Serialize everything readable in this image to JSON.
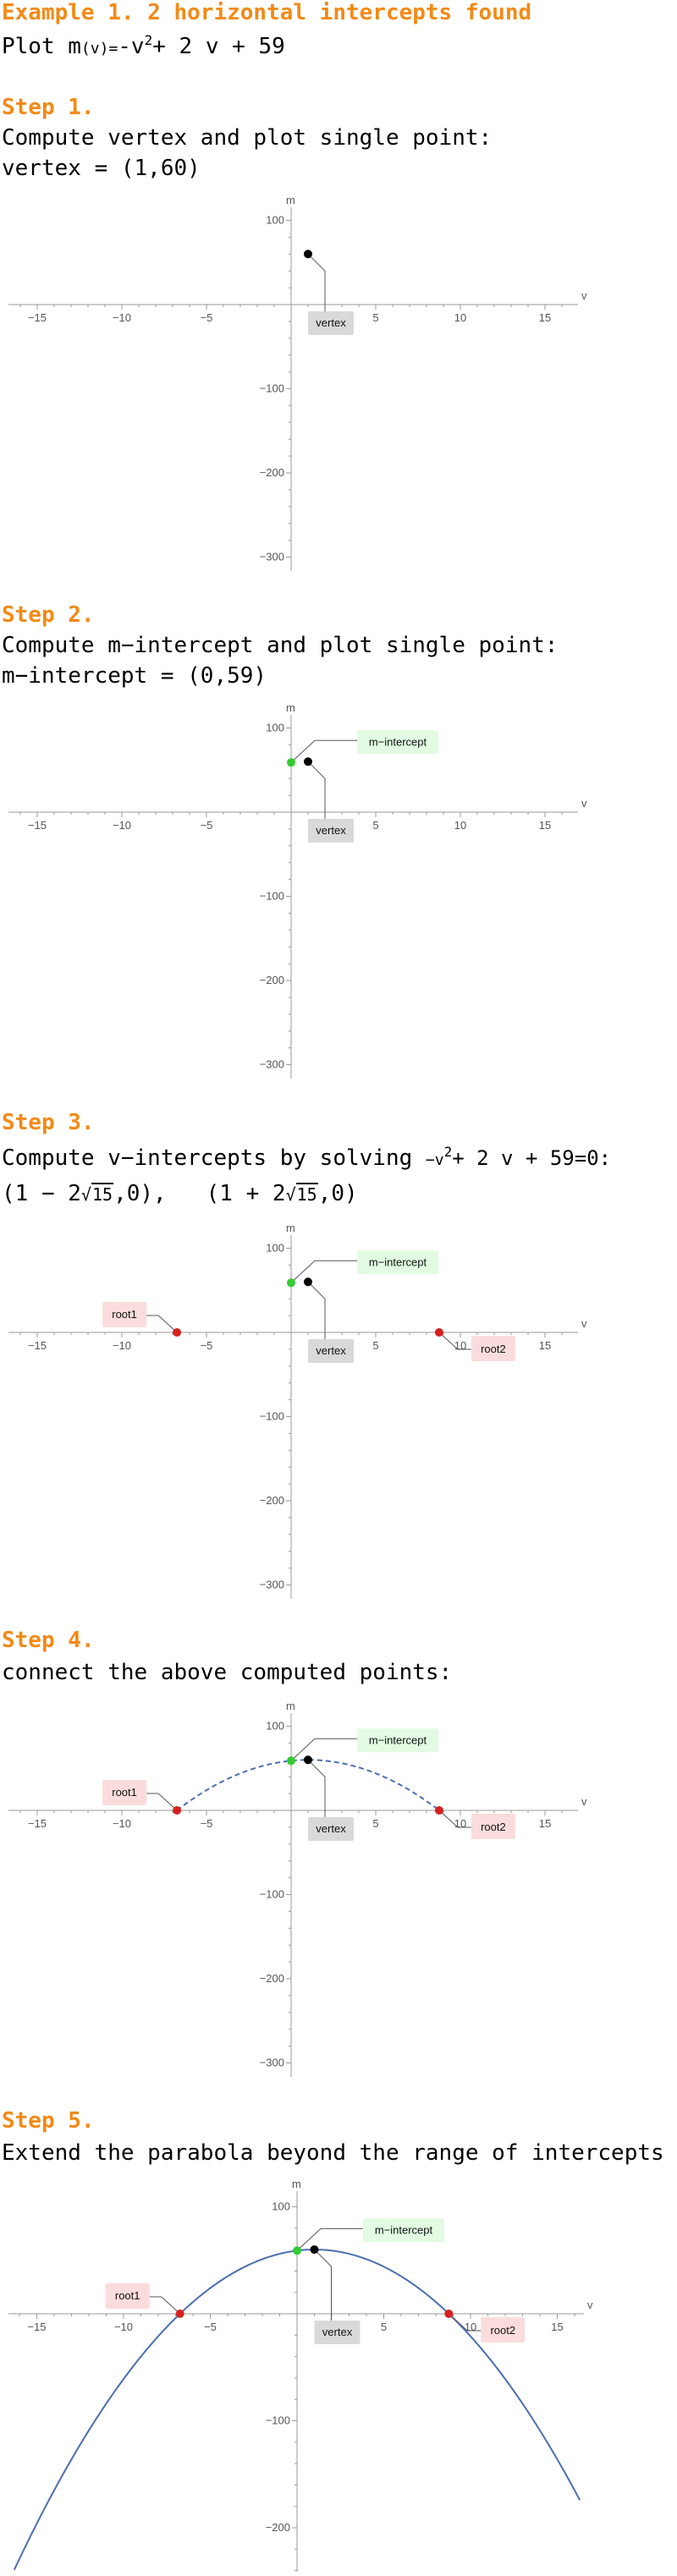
{
  "header": {
    "title": "Example 1. 2 horizontal intercepts found",
    "plot_prefix": "Plot m",
    "plot_arg": "(v)",
    "plot_eq": "=",
    "plot_rhs_a": "-v",
    "plot_rhs_exp": "2",
    "plot_rhs_b": "+ 2 v + 59"
  },
  "steps": [
    {
      "heading": "Step 1.",
      "text": "Compute vertex and plot single point:",
      "result": "vertex = (1,60)"
    },
    {
      "heading": "Step 2.",
      "text": "Compute m−intercept and plot single point:",
      "result": "m−intercept = (0,59)"
    },
    {
      "heading": "Step 3.",
      "text": "Compute v−intercepts by solving",
      "equation_a": "−v",
      "equation_exp": "2",
      "equation_b": "+ 2 v + 59=0:",
      "root1_a": "(1 − 2",
      "root1_rad": "15",
      "root1_b": ",0),",
      "root2_a": "(1 + 2",
      "root2_rad": "15",
      "root2_b": ",0)"
    },
    {
      "heading": "Step 4.",
      "text": "connect the above computed points:"
    },
    {
      "heading": "Step 5.",
      "text": "Extend the parabola beyond the range of intercepts"
    }
  ],
  "axis": {
    "x_label": "v",
    "y_label": "m",
    "x_ticks": [
      "−15",
      "−10",
      "−5",
      "5",
      "10",
      "15"
    ],
    "y_ticks": [
      "100",
      "−100",
      "−200",
      "−300"
    ],
    "y_ticks_step5": [
      "100",
      "−100",
      "−200"
    ]
  },
  "labels": {
    "vertex": "vertex",
    "m_intercept": "m−intercept",
    "root1": "root1",
    "root2": "root2"
  },
  "colors": {
    "heading": "#f28a17",
    "vertex_point": "#000000",
    "m_intercept_point": "#33cc33",
    "root_point": "#d62020",
    "curve": "#4a6fb0",
    "vertex_label_bg": "#d9d9d9",
    "m_intercept_label_bg": "#e2fbe2",
    "root_label_bg": "#fbdcdc"
  },
  "chart_data": [
    {
      "type": "scatter",
      "points": [
        {
          "name": "vertex",
          "x": 1,
          "y": 60
        }
      ],
      "xlabel": "v",
      "ylabel": "m",
      "xlim": [
        -17,
        17
      ],
      "ylim": [
        -310,
        110
      ]
    },
    {
      "type": "scatter",
      "points": [
        {
          "name": "vertex",
          "x": 1,
          "y": 60
        },
        {
          "name": "m-intercept",
          "x": 0,
          "y": 59
        }
      ],
      "xlabel": "v",
      "ylabel": "m",
      "xlim": [
        -17,
        17
      ],
      "ylim": [
        -310,
        110
      ]
    },
    {
      "type": "scatter",
      "points": [
        {
          "name": "vertex",
          "x": 1,
          "y": 60
        },
        {
          "name": "m-intercept",
          "x": 0,
          "y": 59
        },
        {
          "name": "root1",
          "x": -6.746,
          "y": 0
        },
        {
          "name": "root2",
          "x": 8.746,
          "y": 0
        }
      ],
      "xlabel": "v",
      "ylabel": "m",
      "xlim": [
        -17,
        17
      ],
      "ylim": [
        -310,
        110
      ]
    },
    {
      "type": "line",
      "function": "m(v) = -v^2 + 2v + 59",
      "domain": [
        -6.746,
        8.746
      ],
      "style": "dashed",
      "points": [
        {
          "name": "vertex",
          "x": 1,
          "y": 60
        },
        {
          "name": "m-intercept",
          "x": 0,
          "y": 59
        },
        {
          "name": "root1",
          "x": -6.746,
          "y": 0
        },
        {
          "name": "root2",
          "x": 8.746,
          "y": 0
        }
      ],
      "xlabel": "v",
      "ylabel": "m",
      "xlim": [
        -17,
        17
      ],
      "ylim": [
        -310,
        110
      ]
    },
    {
      "type": "line",
      "function": "m(v) = -v^2 + 2v + 59",
      "domain": [
        -16.3,
        16.3
      ],
      "style": "solid",
      "points": [
        {
          "name": "vertex",
          "x": 1,
          "y": 60
        },
        {
          "name": "m-intercept",
          "x": 0,
          "y": 59
        },
        {
          "name": "root1",
          "x": -6.746,
          "y": 0
        },
        {
          "name": "root2",
          "x": 8.746,
          "y": 0
        }
      ],
      "xlabel": "v",
      "ylabel": "m",
      "xlim": [
        -18,
        18
      ],
      "ylim": [
        -260,
        110
      ]
    }
  ]
}
